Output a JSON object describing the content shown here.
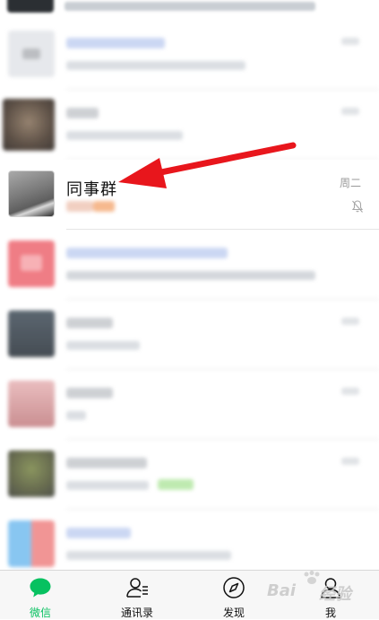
{
  "chat_list": {
    "featured_chat": {
      "name": "同事群",
      "time": "周二",
      "muted": true
    }
  },
  "tabs": [
    {
      "id": "chats",
      "label": "微信",
      "icon": "chat-bubble-icon",
      "active": true
    },
    {
      "id": "contacts",
      "label": "通讯录",
      "icon": "contacts-icon",
      "active": false
    },
    {
      "id": "discover",
      "label": "发现",
      "icon": "compass-icon",
      "active": false
    },
    {
      "id": "me",
      "label": "我",
      "icon": "person-icon",
      "active": false
    }
  ],
  "colors": {
    "accent": "#07c160",
    "arrow": "#e8161c",
    "tabbar_bg": "#f7f7f7"
  },
  "watermark": "Baidu 经验"
}
